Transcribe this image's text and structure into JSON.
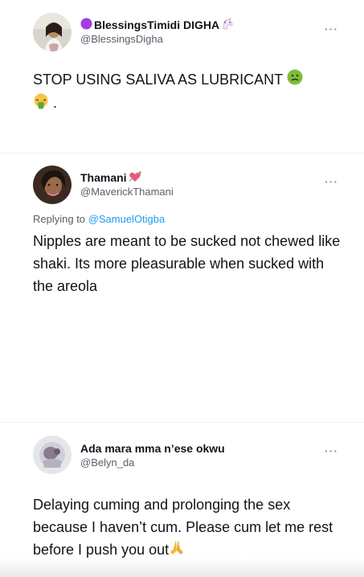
{
  "tweets": [
    {
      "display_name": "BlessingsTimidi DIGHA",
      "handle": "@BlessingsDigha",
      "body_line1": "STOP USING SALIVA AS LUBRICANT",
      "body_line2": "."
    },
    {
      "display_name": "Thamani",
      "handle": "@MaverickThamani",
      "replying_prefix": "Replying to",
      "replying_to": "@SamuelOtigba",
      "body": "Nipples are meant to be sucked not chewed like shaki. Its more pleasurable when sucked with the areola"
    },
    {
      "display_name": "Ada mara mma n’ese okwu",
      "handle": "@Belyn_da",
      "body": "Delaying cuming and prolonging the sex because I haven’t cum. Please cum let me rest before I push you out"
    }
  ],
  "more_label": "···",
  "icons": {
    "purple_circle": "purple-circle-emoji",
    "unicorn": "unicorn-emoji",
    "nauseated": "nauseated-face-emoji",
    "vomiting": "vomiting-face-emoji",
    "heart_arrow": "heart-with-arrow-emoji",
    "folded_hands": "folded-hands-emoji"
  },
  "colors": {
    "link": "#1d9bf0",
    "secondary_text": "#586069",
    "more_icon": "#8899a6"
  }
}
